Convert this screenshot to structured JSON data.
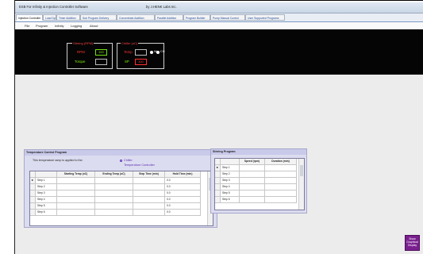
{
  "window": {
    "title": "ESB For Infinity & Injection Controller Software",
    "title_right": "by J.HENK Labs Inc."
  },
  "tabs": [
    {
      "label": "Injection Controller"
    },
    {
      "label": "Load Dye"
    },
    {
      "label": "Timer Addition"
    },
    {
      "label": "Sub Program Delivery"
    },
    {
      "label": "Concentrate Addition"
    },
    {
      "label": "Parallel Addition"
    },
    {
      "label": "Program Builder"
    },
    {
      "label": "Pump Manual Control"
    },
    {
      "label": "User Supported Programs"
    }
  ],
  "menu": [
    "File",
    "Program",
    "Infinity",
    "Logging",
    "About"
  ],
  "stirring": {
    "title": "Stirring (RPM)",
    "rpm_label": "RPM",
    "rpm_value": "100",
    "torque_label": "Torque",
    "torque_value": ""
  },
  "chiller": {
    "title": "Chiller (oC)",
    "temp_label": "Temp",
    "temp_value": "",
    "sp_label": "SP",
    "sp_value": "100",
    "radio_a": "W",
    "radio_b": "CH"
  },
  "temperature_program": {
    "title": "Temperature Control Program",
    "applied_text": "This temperature ramp is applied to the:",
    "options": [
      "Chiller",
      "Temperature Controller"
    ],
    "columns": [
      "",
      "Starting Temp (oC)",
      "Ending Temp (oC)",
      "Step Time (min)",
      "Hold Time (min)"
    ],
    "rows": [
      {
        "name": "Step 1",
        "marker": "►",
        "start": "",
        "end": "",
        "step": "",
        "hold": "0.0"
      },
      {
        "name": "Step 2",
        "marker": "",
        "start": "",
        "end": "",
        "step": "",
        "hold": "0.0"
      },
      {
        "name": "Step 3",
        "marker": "",
        "start": "",
        "end": "",
        "step": "",
        "hold": "0.0"
      },
      {
        "name": "Step 4",
        "marker": "",
        "start": "",
        "end": "",
        "step": "",
        "hold": "0.0"
      },
      {
        "name": "Step 5",
        "marker": "",
        "start": "",
        "end": "",
        "step": "",
        "hold": "0.0"
      },
      {
        "name": "Step 6",
        "marker": "",
        "start": "",
        "end": "",
        "step": "",
        "hold": "0.0"
      }
    ]
  },
  "stirring_program": {
    "title": "Stirring Program",
    "columns": [
      "",
      "Speed (rpm)",
      "Duration (min)"
    ],
    "rows": [
      {
        "name": "Step 1",
        "marker": "►",
        "speed": "",
        "duration": ""
      },
      {
        "name": "Step 2",
        "marker": "",
        "speed": "",
        "duration": ""
      },
      {
        "name": "Step 3",
        "marker": "",
        "speed": "",
        "duration": ""
      },
      {
        "name": "Step 4",
        "marker": "",
        "speed": "",
        "duration": ""
      },
      {
        "name": "Step 5",
        "marker": "",
        "speed": "",
        "duration": ""
      },
      {
        "name": "Step 6",
        "marker": "",
        "speed": "",
        "duration": ""
      }
    ]
  },
  "bottom_button": {
    "label": "Show Graphical Display"
  }
}
